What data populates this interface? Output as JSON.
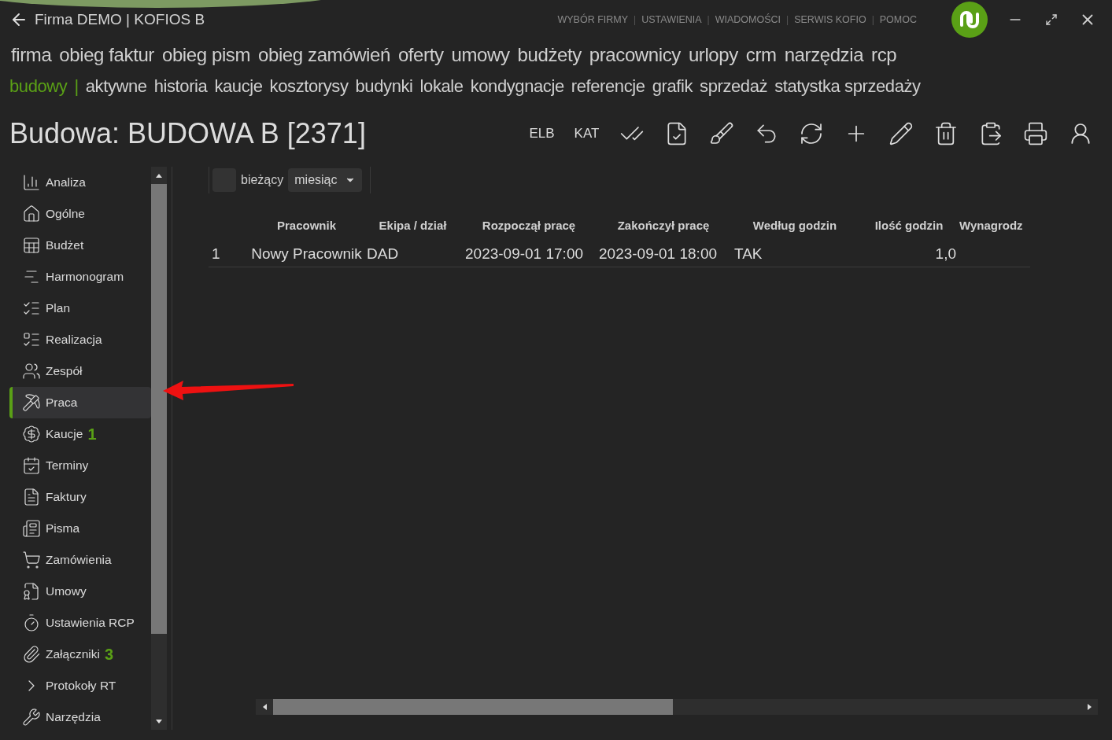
{
  "window": {
    "title": "Firma DEMO | KOFIOS B"
  },
  "top_links": {
    "separator": "|",
    "items": [
      "WYBÓR FIRMY",
      "USTAWIENIA",
      "WIADOMOŚCI",
      "SERWIS KOFIO",
      "POMOC"
    ]
  },
  "main_menu": [
    "firma",
    "obieg faktur",
    "obieg pism",
    "obieg zamówień",
    "oferty",
    "umowy",
    "budżety",
    "pracownicy",
    "urlopy",
    "crm",
    "narzędzia",
    "rcp"
  ],
  "sub_menu": {
    "section": "budowy",
    "separator": "|",
    "items": [
      "aktywne",
      "historia",
      "kaucje",
      "kosztorysy",
      "budynki",
      "lokale",
      "kondygnacje",
      "referencje",
      "grafik",
      "sprzedaż",
      "statystka sprzedaży"
    ]
  },
  "page_title": "Budowa: BUDOWA B [2371]",
  "toolbar": {
    "text_buttons": [
      "ELB",
      "KAT"
    ]
  },
  "sidebar": {
    "items": [
      {
        "label": "Analiza",
        "selected": false
      },
      {
        "label": "Ogólne",
        "selected": false
      },
      {
        "label": "Budżet",
        "selected": false
      },
      {
        "label": "Harmonogram",
        "selected": false
      },
      {
        "label": "Plan",
        "selected": false
      },
      {
        "label": "Realizacja",
        "selected": false
      },
      {
        "label": "Zespół",
        "selected": false
      },
      {
        "label": "Praca",
        "selected": true
      },
      {
        "label": "Kaucje",
        "count": "1",
        "selected": false
      },
      {
        "label": "Terminy",
        "selected": false
      },
      {
        "label": "Faktury",
        "selected": false
      },
      {
        "label": "Pisma",
        "selected": false
      },
      {
        "label": "Zamówienia",
        "selected": false
      },
      {
        "label": "Umowy",
        "selected": false
      },
      {
        "label": "Ustawienia RCP",
        "selected": false
      },
      {
        "label": "Załączniki",
        "count": "3",
        "selected": false
      },
      {
        "label": "Protokoły RT",
        "selected": false
      },
      {
        "label": "Narzędzia",
        "selected": false
      }
    ]
  },
  "filter": {
    "current": {
      "label": "bieżący",
      "checked": false
    },
    "period": {
      "value": "miesiąc"
    }
  },
  "table": {
    "columns": [
      "Pracownik",
      "Ekipa / dział",
      "Rozpoczął pracę",
      "Zakończył pracę",
      "Według godzin",
      "Ilość godzin",
      "Wynagrodz"
    ],
    "rows": [
      {
        "number": "1",
        "cells": [
          "Nowy Pracownik",
          "DAD",
          "2023-09-01 17:00",
          "2023-09-01 18:00",
          "TAK",
          "1,0",
          ""
        ]
      }
    ]
  }
}
